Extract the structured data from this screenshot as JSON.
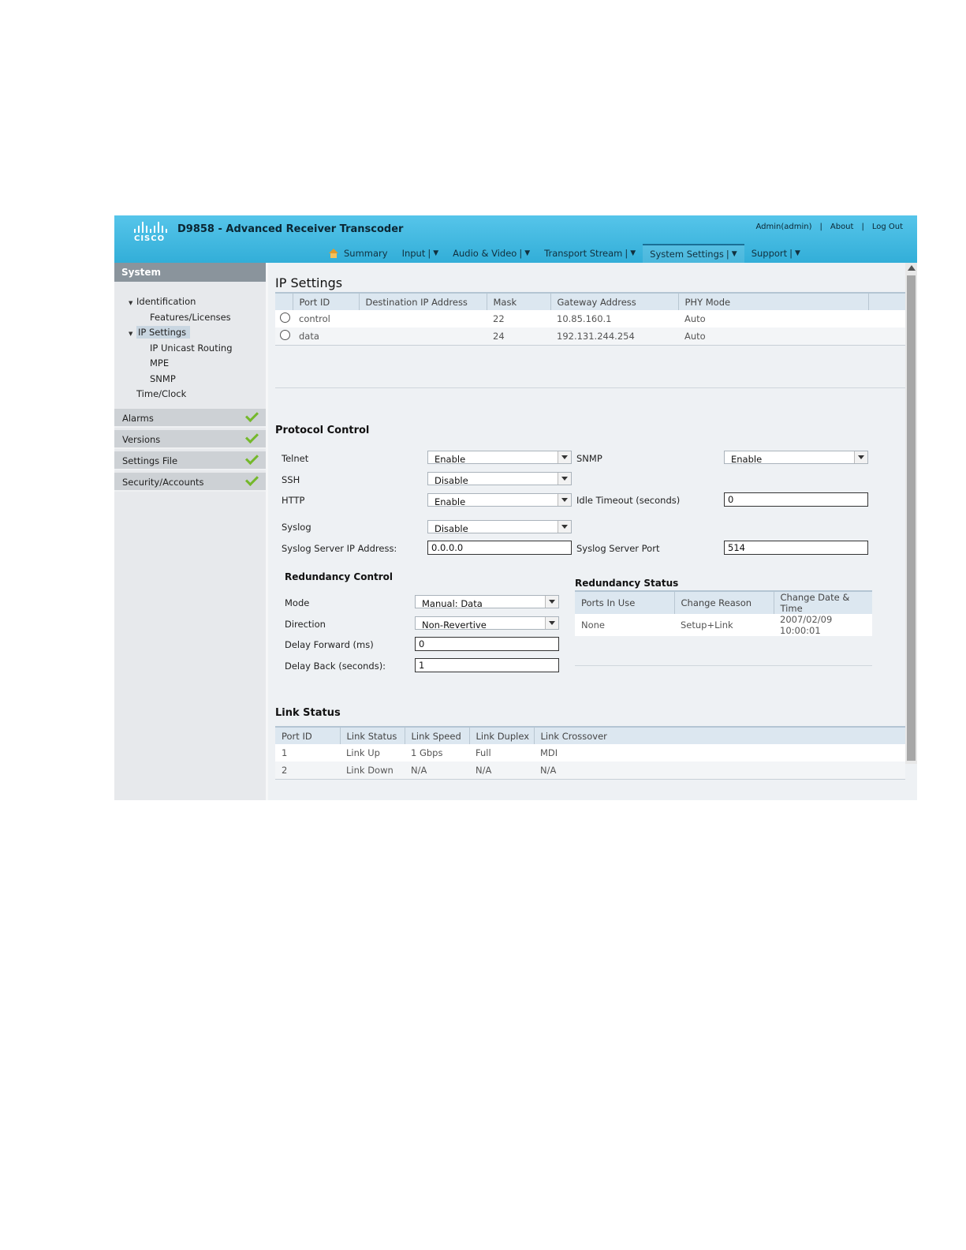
{
  "header": {
    "logo_text": "CISCO",
    "title": "D9858 - Advanced Receiver Transcoder",
    "user": "Admin(admin)",
    "about": "About",
    "logout": "Log Out"
  },
  "nav": [
    {
      "label": "Summary"
    },
    {
      "label": "Input"
    },
    {
      "label": "Audio & Video"
    },
    {
      "label": "Transport Stream"
    },
    {
      "label": "System Settings"
    },
    {
      "label": "Support"
    }
  ],
  "sidebar": {
    "header": "System",
    "tree": [
      {
        "label": "Identification"
      },
      {
        "label": "Features/Licenses"
      },
      {
        "label": "IP Settings"
      },
      {
        "label": "IP Unicast Routing"
      },
      {
        "label": "MPE"
      },
      {
        "label": "SNMP"
      },
      {
        "label": "Time/Clock"
      }
    ],
    "groups": [
      {
        "label": "Alarms"
      },
      {
        "label": "Versions"
      },
      {
        "label": "Settings File"
      },
      {
        "label": "Security/Accounts"
      }
    ]
  },
  "ip_settings": {
    "title": "IP Settings",
    "columns": [
      "Port ID",
      "Destination IP Address",
      "Mask",
      "Gateway Address",
      "PHY Mode"
    ],
    "rows": [
      {
        "port": "control",
        "dest": "",
        "mask": "22",
        "gateway": "10.85.160.1",
        "phy": "Auto"
      },
      {
        "port": "data",
        "dest": "",
        "mask": "24",
        "gateway": "192.131.244.254",
        "phy": "Auto"
      }
    ]
  },
  "protocol": {
    "title": "Protocol Control",
    "telnet_label": "Telnet",
    "telnet_value": "Enable",
    "ssh_label": "SSH",
    "ssh_value": "Disable",
    "http_label": "HTTP",
    "http_value": "Enable",
    "syslog_label": "Syslog",
    "syslog_value": "Disable",
    "syslog_ip_label": "Syslog Server IP Address:",
    "syslog_ip_value": "0.0.0.0",
    "snmp_label": "SNMP",
    "snmp_value": "Enable",
    "idle_label": "Idle Timeout (seconds)",
    "idle_value": "0",
    "syslog_port_label": "Syslog Server Port",
    "syslog_port_value": "514"
  },
  "redundancy_control": {
    "title": "Redundancy Control",
    "mode_label": "Mode",
    "mode_value": "Manual: Data",
    "direction_label": "Direction",
    "direction_value": "Non-Revertive",
    "delay_fwd_label": "Delay Forward (ms)",
    "delay_fwd_value": "0",
    "delay_back_label": "Delay Back (seconds):",
    "delay_back_value": "1"
  },
  "redundancy_status": {
    "title": "Redundancy Status",
    "columns": [
      "Ports In Use",
      "Change Reason",
      "Change Date & Time"
    ],
    "row": {
      "ports": "None",
      "reason": "Setup+Link",
      "datetime": "2007/02/09 10:00:01"
    }
  },
  "link_status": {
    "title": "Link Status",
    "columns": [
      "Port ID",
      "Link Status",
      "Link Speed",
      "Link Duplex",
      "Link Crossover"
    ],
    "rows": [
      {
        "port": "1",
        "status": "Link Up",
        "speed": "1 Gbps",
        "duplex": "Full",
        "crossover": "MDI"
      },
      {
        "port": "2",
        "status": "Link Down",
        "speed": "N/A",
        "duplex": "N/A",
        "crossover": "N/A"
      }
    ]
  }
}
